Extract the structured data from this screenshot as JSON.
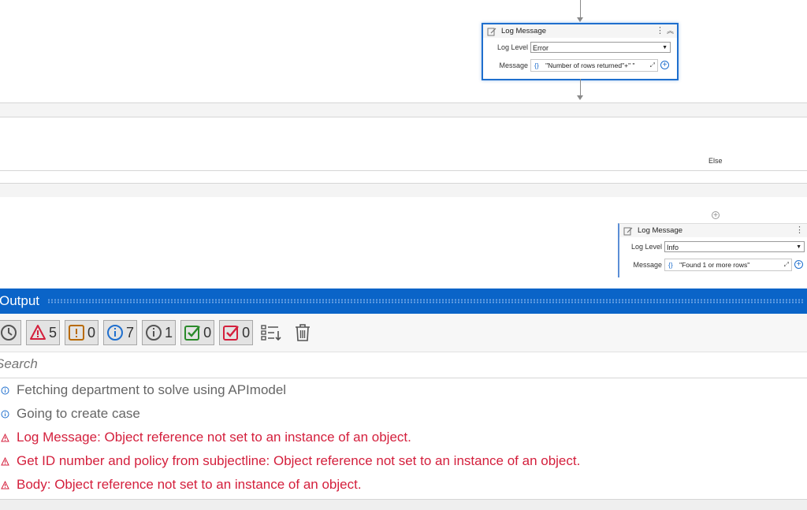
{
  "designer": {
    "activity_1": {
      "title": "Log Message",
      "log_level_label": "Log Level",
      "log_level_value": "Error",
      "message_label": "Message",
      "message_value": "\"Number of rows returned\"+\" \""
    },
    "else_label": "Else",
    "activity_2": {
      "title": "Log Message",
      "log_level_label": "Log Level",
      "log_level_value": "Info",
      "message_label": "Message",
      "message_value": "\"Found 1 or more rows\""
    }
  },
  "output": {
    "title": "Output",
    "filters": {
      "warnings_count": "5",
      "errors_count": "0",
      "info_count": "7",
      "trace_count": "1",
      "success_count": "0",
      "failed_count": "0"
    },
    "search": {
      "placeholder": "Search"
    },
    "entries": [
      {
        "level": "info",
        "text": "Fetching department to solve using APImodel"
      },
      {
        "level": "info",
        "text": "Going to create case"
      },
      {
        "level": "error",
        "text": "Log Message: Object reference not set to an instance of an object."
      },
      {
        "level": "error",
        "text": "Get ID number and policy from subjectline: Object reference not set to an instance of an object."
      },
      {
        "level": "error",
        "text": "Body: Object reference not set to an instance of an object."
      }
    ]
  },
  "colors": {
    "accent": "#0a64c8",
    "error": "#d41f3c",
    "info": "#1f6fce",
    "warning_icon": "#d41f3c",
    "exclaim_icon": "#b86a00",
    "success_icon": "#2a8a2a"
  }
}
